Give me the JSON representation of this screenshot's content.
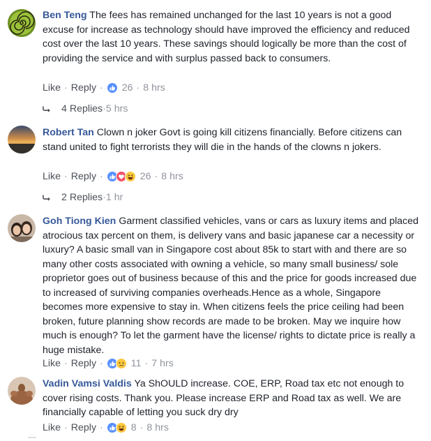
{
  "comments": [
    {
      "author": "Ben Teng",
      "text": "The fees has remained unchanged for the last 10 years is not a good excuse for increase as technology should have improved the efficiency and reduced cost over the last 10 years. These savings should logically be more than the cost of providing the service and with surplus passed back to consumers.",
      "like_label": "Like",
      "reply_label": "Reply",
      "reactions": [
        "like"
      ],
      "reaction_count": "26",
      "time": "8 hrs",
      "replies_label": "4 Replies",
      "replies_time": "5 hrs",
      "avatar": "spiral-avatar"
    },
    {
      "author": "Robert Tan",
      "text": "Clown n joker Govt is going kill citizens financially. Before citizens can stand united to fight terrorists they will die in the hands of the clowns n jokers.",
      "like_label": "Like",
      "reply_label": "Reply",
      "reactions": [
        "like",
        "love",
        "haha"
      ],
      "reaction_count": "26",
      "time": "8 hrs",
      "replies_label": "2 Replies",
      "replies_time": "1 hr",
      "avatar": "sunset-avatar"
    },
    {
      "author": "Goh Tiong Kien",
      "text": "Garment classified vehicles, vans or cars as luxury items and placed atrocious tax percent on them, is delivery vans and basic japanese car a necessity or luxury? A basic small van in Singapore cost about 85k to start with and there are so many other costs associated with owning a vehicle, so many small business/ sole proprietor goes out of business because of this and the price for goods increased due to increased of surviving companies overheads.Hence as a whole, Singapore becomes more expensive to stay in. When citizens feels the price ceiling had been broken, future planning show records are made to be broken. May we inquire how much is enough? To let the garment have the license/ rights to dictate price is really a huge mistake.",
      "like_label": "Like",
      "reply_label": "Reply",
      "reactions": [
        "like",
        "sad"
      ],
      "reaction_count": "11",
      "time": "7 hrs",
      "avatar": "people-avatar"
    },
    {
      "author": "Vadin Vamsi Valdis",
      "text": "Ya ShOULD increase. COE, ERP, Road tax etc not enough to cover rising costs. Thank you. Please increase ERP and Road tax as well. We are financially capable of letting you suck dry dry",
      "like_label": "Like",
      "reply_label": "Reply",
      "reactions": [
        "like",
        "haha"
      ],
      "reaction_count": "8",
      "time": "8 hrs",
      "avatar": "muscle-avatar"
    }
  ],
  "colors": {
    "author": "#365899",
    "text": "#1d2129",
    "meta": "#90949c",
    "like_blue": "#5890ff",
    "love_red": "#f25268",
    "haha_yellow": "#fcc93e"
  }
}
